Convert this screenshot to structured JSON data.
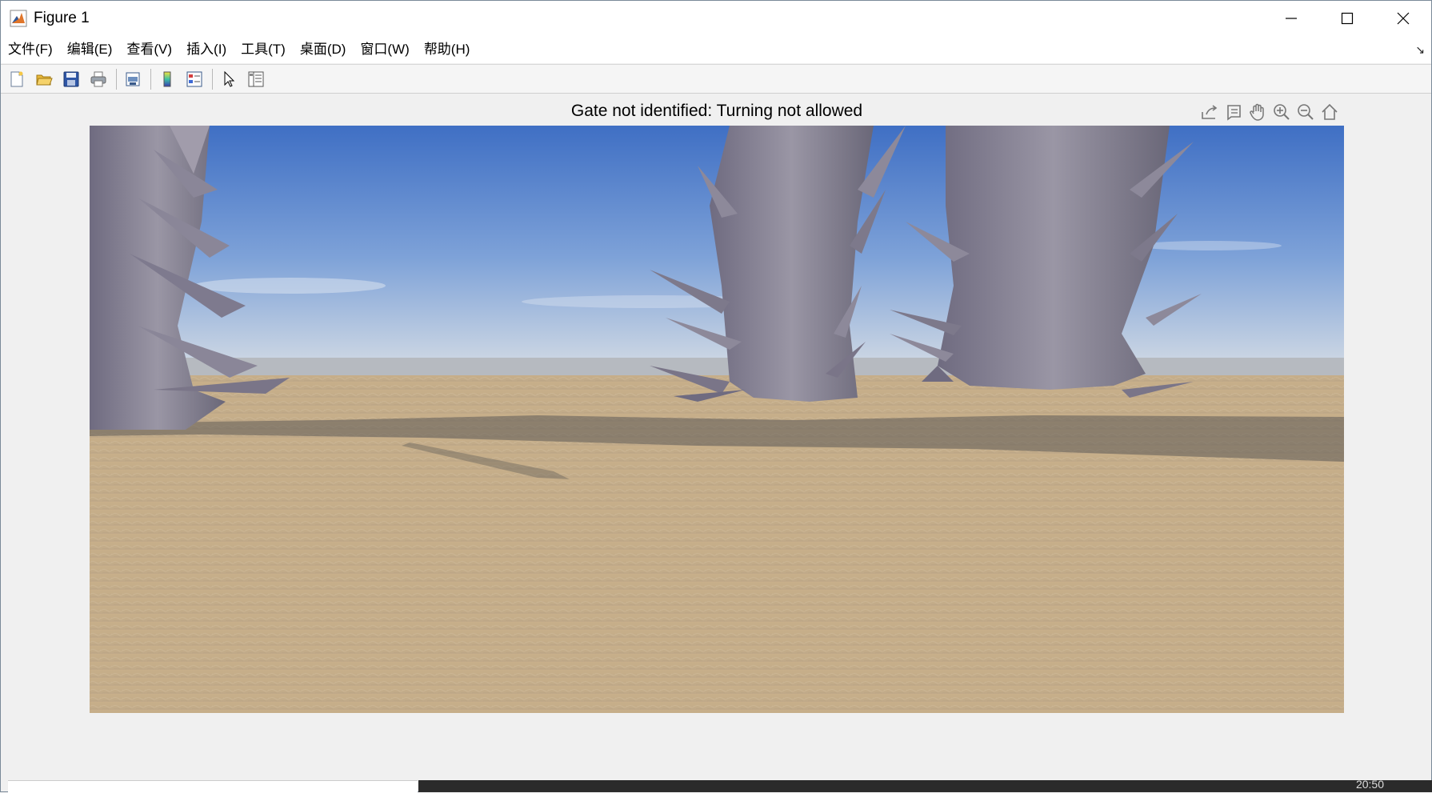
{
  "window": {
    "title": "Figure 1",
    "app_icon": "matlab-icon",
    "controls": [
      "minimize-icon",
      "maximize-icon",
      "close-icon"
    ]
  },
  "menubar": {
    "items": [
      {
        "label": "文件(F)"
      },
      {
        "label": "编辑(E)"
      },
      {
        "label": "查看(V)"
      },
      {
        "label": "插入(I)"
      },
      {
        "label": "工具(T)"
      },
      {
        "label": "桌面(D)"
      },
      {
        "label": "窗口(W)"
      },
      {
        "label": "帮助(H)"
      }
    ],
    "dock_icon": "dock-arrow-icon"
  },
  "toolbar": {
    "buttons": [
      "new-figure-icon",
      "open-file-icon",
      "save-icon",
      "print-icon",
      "print-preview-icon",
      "colorbar-icon",
      "legend-icon",
      "pointer-icon",
      "property-inspector-icon"
    ]
  },
  "figure": {
    "title": "Gate not identified: Turning not allowed",
    "axes_toolbar": [
      "export-icon",
      "data-tips-icon",
      "pan-hand-icon",
      "zoom-in-icon",
      "zoom-out-icon",
      "home-icon"
    ]
  },
  "taskbar": {
    "time": "20:50"
  },
  "colors": {
    "sky_top": "#3f6fc4",
    "sky_horizon": "#cfd8e4",
    "ground": "#c8b291",
    "rock": "#7d7a8e"
  }
}
